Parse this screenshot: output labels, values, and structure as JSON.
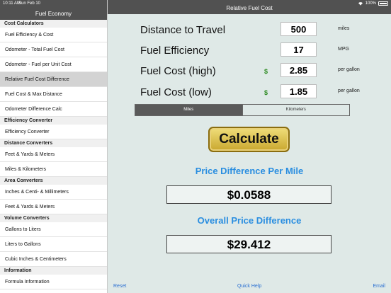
{
  "status_bar": {
    "time": "10:11 AM",
    "date": "Sun Feb 10",
    "battery": "100%"
  },
  "sidebar": {
    "title": "Fuel Economy",
    "entries": [
      {
        "kind": "section",
        "label": "Cost Calculators"
      },
      {
        "kind": "item",
        "label": "Fuel Efficiency & Cost"
      },
      {
        "kind": "item",
        "label": "Odometer - Total Fuel Cost"
      },
      {
        "kind": "item",
        "label": "Odometer - Fuel per Unit Cost"
      },
      {
        "kind": "item",
        "label": "Relative Fuel Cost Difference",
        "selected": true
      },
      {
        "kind": "item",
        "label": "Fuel Cost & Max Distance"
      },
      {
        "kind": "item",
        "label": "Odometer Difference Calc"
      },
      {
        "kind": "section",
        "label": "Efficiency Converter"
      },
      {
        "kind": "item",
        "label": "Efficiency Converter"
      },
      {
        "kind": "section",
        "label": "Distance Converters"
      },
      {
        "kind": "item",
        "label": "Feet & Yards & Meters"
      },
      {
        "kind": "item",
        "label": "Miles & Kilometers"
      },
      {
        "kind": "section",
        "label": "Area Converters"
      },
      {
        "kind": "item",
        "label": "Inches & Centi- & Millimeters"
      },
      {
        "kind": "item",
        "label": "Feet & Yards & Meters"
      },
      {
        "kind": "section",
        "label": "Volume Converters"
      },
      {
        "kind": "item",
        "label": "Gallons to Liters"
      },
      {
        "kind": "item",
        "label": "Liters to Gallons"
      },
      {
        "kind": "item",
        "label": "Cubic Inches & Centimeters"
      },
      {
        "kind": "section",
        "label": "Information"
      },
      {
        "kind": "item",
        "label": "Formula Information"
      }
    ]
  },
  "main": {
    "title": "Relative Fuel Cost",
    "fields": {
      "distance": {
        "label": "Distance to Travel",
        "value": "500",
        "unit": "miles"
      },
      "efficiency": {
        "label": "Fuel Efficiency",
        "value": "17",
        "unit": "MPG"
      },
      "cost_high": {
        "label": "Fuel Cost (high)",
        "currency": "$",
        "value": "2.85",
        "unit": "per gallon"
      },
      "cost_low": {
        "label": "Fuel Cost (low)",
        "currency": "$",
        "value": "1.85",
        "unit": "per gallon"
      }
    },
    "units_toggle": {
      "miles": "Miles",
      "kilometers": "Kilometers",
      "selected": "miles"
    },
    "calculate_label": "Calculate",
    "price_diff_per_mile": {
      "title": "Price Difference Per Mile",
      "value": "$0.0588"
    },
    "overall_price_diff": {
      "title": "Overall Price Difference",
      "value": "$29.412"
    },
    "footer": {
      "reset": "Reset",
      "help": "Quick Help",
      "email": "Email"
    }
  },
  "colors": {
    "header": "#515151",
    "accent_blue": "#2a8ee0",
    "dollar_green": "#2a8a1f",
    "link_blue": "#2a6fd1",
    "button_gold": "#d9bf4a"
  }
}
